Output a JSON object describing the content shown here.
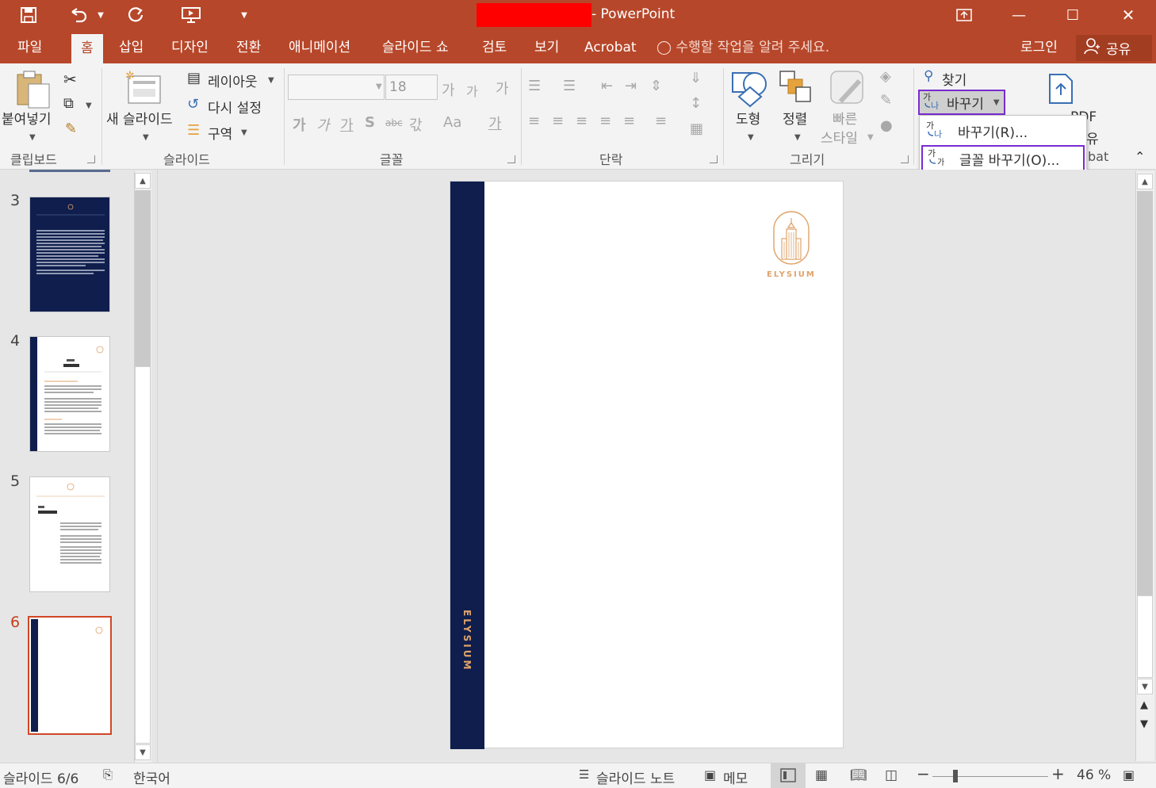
{
  "app": {
    "title_suffix": "- PowerPoint",
    "icons": [
      "save-icon",
      "undo-icon",
      "redo-icon",
      "start-from-beginning-icon",
      "customize-qat-icon"
    ]
  },
  "window": {
    "ribbon_display": "↑",
    "minimize": "—",
    "maximize": "☐",
    "close": "✕"
  },
  "tabs": [
    {
      "label": "파일"
    },
    {
      "label": "홈"
    },
    {
      "label": "삽입"
    },
    {
      "label": "디자인"
    },
    {
      "label": "전환"
    },
    {
      "label": "애니메이션"
    },
    {
      "label": "슬라이드 쇼"
    },
    {
      "label": "검토"
    },
    {
      "label": "보기"
    },
    {
      "label": "Acrobat"
    }
  ],
  "tellme": "수행할 작업을 알려 주세요.",
  "account": {
    "login": "로그인",
    "share": "공유"
  },
  "ribbon": {
    "clipboard": {
      "label": "클립보드",
      "paste": "붙여넣기"
    },
    "slides": {
      "label": "슬라이드",
      "new_slide": "새 슬라이드",
      "layout": "레이아웃",
      "reset": "다시 설정",
      "section": "구역"
    },
    "font": {
      "label": "글꼴",
      "font_size": "18",
      "bold": "가",
      "italic": "가",
      "underline": "가",
      "shadow": "S",
      "strike": "abc",
      "spacing": "갃",
      "case": "Aa",
      "color": "가",
      "grow": "가",
      "shrink": "가",
      "clear": "가"
    },
    "paragraph": {
      "label": "단락"
    },
    "drawing": {
      "label": "그리기",
      "shapes": "도형",
      "arrange": "정렬",
      "quick_styles_1": "빠른",
      "quick_styles_2": "스타일"
    },
    "editing": {
      "find": "찾기",
      "replace": "바꾸기"
    },
    "acrobat": {
      "partial_1": "PDF",
      "partial_2": "유",
      "partial_label": "bat"
    }
  },
  "replace_menu": [
    {
      "label": "바꾸기(R)..."
    },
    {
      "label": "글꼴 바꾸기(O)..."
    }
  ],
  "thumbnails": [
    {
      "number": "3"
    },
    {
      "number": "4"
    },
    {
      "number": "5"
    },
    {
      "number": "6"
    }
  ],
  "slide": {
    "brand_vertical": "ELYSIUM",
    "brand_logo": "ELYSIUM"
  },
  "statusbar": {
    "slide_counter": "슬라이드 6/6",
    "language": "한국어",
    "notes": "슬라이드 노트",
    "comments": "메모",
    "zoom": "46 %"
  },
  "colors": {
    "accent": "#b7472a",
    "slide_bar": "#0f1e4d",
    "brand_gold": "#e0a36a",
    "highlight": "#7a2bd1"
  }
}
